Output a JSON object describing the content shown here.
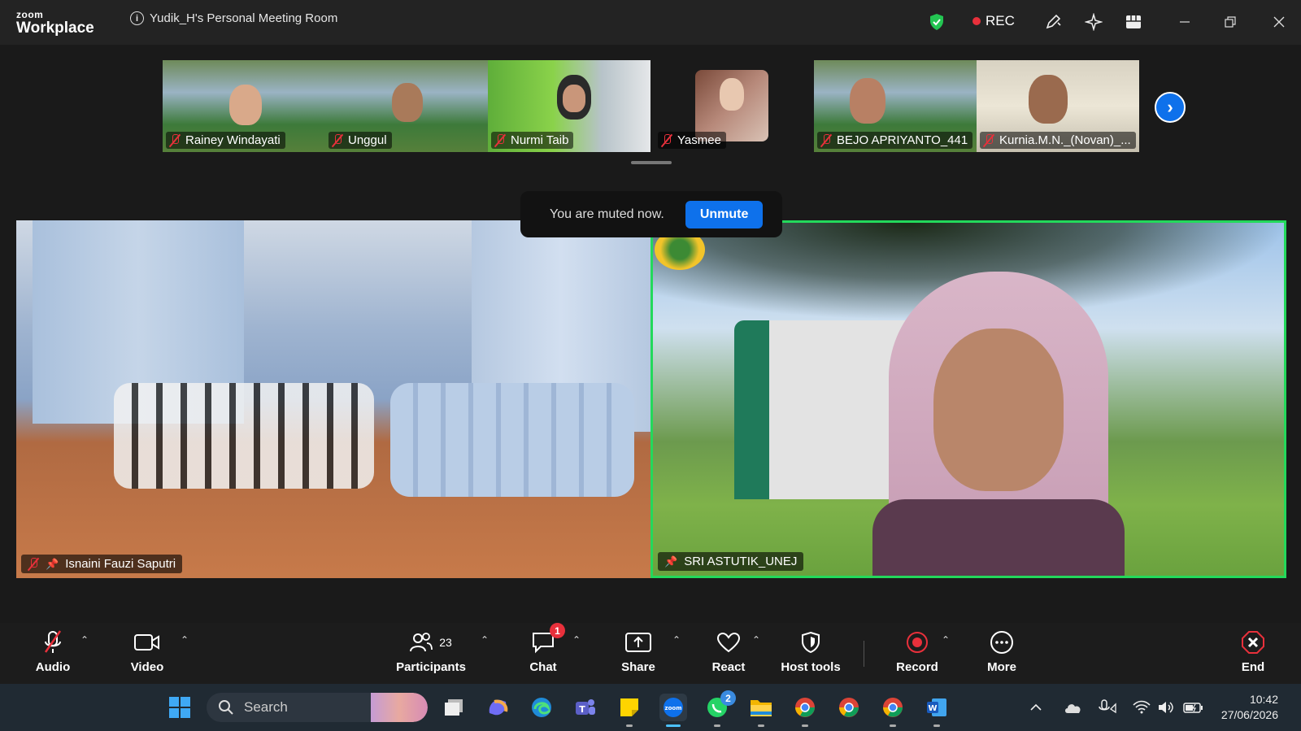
{
  "app": {
    "logo_small": "zoom",
    "logo_big": "Workplace",
    "meeting_title": "Yudik_H's Personal Meeting Room",
    "rec_label": "REC"
  },
  "thumbnails": [
    {
      "name": "Rainey Windayati",
      "muted": true
    },
    {
      "name": "Unggul",
      "muted": true
    },
    {
      "name": "Nurmi Taib",
      "muted": true
    },
    {
      "name": "Yasmee",
      "muted": true
    },
    {
      "name": "BEJO APRIYANTO_441",
      "muted": true
    },
    {
      "name": "Kurnia.M.N._(Novan)_...",
      "muted": true
    }
  ],
  "toast": {
    "message": "You are muted now.",
    "button": "Unmute"
  },
  "main_videos": [
    {
      "name": "Isnaini Fauzi Saputri",
      "muted": true,
      "pinned": true
    },
    {
      "name": "SRI ASTUTIK_UNEJ",
      "muted": false,
      "pinned": true,
      "active_speaker": true
    }
  ],
  "toolbar": {
    "audio": "Audio",
    "video": "Video",
    "participants": "Participants",
    "participants_count": "23",
    "chat": "Chat",
    "chat_badge": "1",
    "share": "Share",
    "react": "React",
    "host_tools": "Host tools",
    "record": "Record",
    "more": "More",
    "end": "End"
  },
  "taskbar": {
    "search_placeholder": "Search",
    "whatsapp_badge": "2",
    "time": "10:42",
    "date": "27/06/2026"
  },
  "colors": {
    "zoom_blue": "#0e71eb",
    "active_speaker": "#23d95b",
    "muted_red": "#e8303b"
  }
}
